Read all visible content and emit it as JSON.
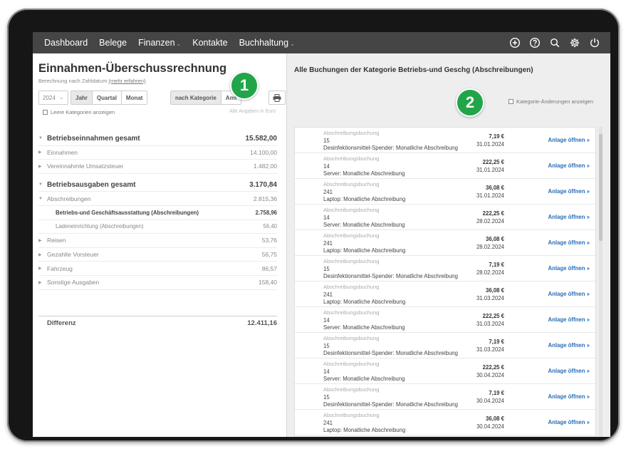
{
  "nav": {
    "items": [
      {
        "label": "Dashboard",
        "caret": false
      },
      {
        "label": "Belege",
        "caret": false
      },
      {
        "label": "Finanzen",
        "caret": true
      },
      {
        "label": "Kontakte",
        "caret": false
      },
      {
        "label": "Buchhaltung",
        "caret": true
      }
    ],
    "icons": [
      "add-circle-icon",
      "help-icon",
      "search-icon",
      "settings-icon",
      "power-icon"
    ]
  },
  "left": {
    "title": "Einnahmen-Überschussrechnung",
    "subtitle": "Berechnung nach Zahldatum",
    "learn_more": "(mehr erfahren)",
    "year": "2024",
    "period_buttons": [
      "Jahr",
      "Quartal",
      "Monat"
    ],
    "view_buttons": [
      "nach Kategorie",
      "Amt"
    ],
    "empty_categories_label": "Leere Kategorien anzeigen",
    "all_cents_label": "Alle Angaben in Euro",
    "rows": [
      {
        "kind": "group",
        "toggle": "▼",
        "label": "Betriebseinnahmen gesamt",
        "value": "15.582,00"
      },
      {
        "kind": "item",
        "toggle": "▶",
        "label": "Einnahmen",
        "value": "14.100,00"
      },
      {
        "kind": "item",
        "toggle": "▶",
        "label": "Vereinnahmte Umsatzsteuer",
        "value": "1.482,00"
      },
      {
        "kind": "group",
        "toggle": "▼",
        "label": "Betriebsausgaben gesamt",
        "value": "3.170,84"
      },
      {
        "kind": "item",
        "toggle": "▼",
        "label": "Abschreibungen",
        "value": "2.815,36"
      },
      {
        "kind": "subbold",
        "toggle": "",
        "label": "Betriebs-und Geschäftsausstattung (Abschreibungen)",
        "value": "2.758,96"
      },
      {
        "kind": "sub",
        "toggle": "",
        "label": "Ladeneinrichtung (Abschreibungen)",
        "value": "56,40"
      },
      {
        "kind": "item",
        "toggle": "▶",
        "label": "Reisen",
        "value": "53,76"
      },
      {
        "kind": "item",
        "toggle": "▶",
        "label": "Gezahlte Vorsteuer",
        "value": "56,75"
      },
      {
        "kind": "item",
        "toggle": "▶",
        "label": "Fahrzeug",
        "value": "86,57"
      },
      {
        "kind": "item",
        "toggle": "▶",
        "label": "Sonstige Ausgaben",
        "value": "158,40"
      }
    ],
    "difference_label": "Differenz",
    "difference_value": "12.411,16"
  },
  "right": {
    "title": "Alle Buchungen der Kategorie Betriebs-und Geschg (Abschreibungen)",
    "category_changes_label": "Kategorie-Änderungen anzeigen",
    "open_label": "Anlage öffnen",
    "entries": [
      {
        "type": "Abschreibungsbuchung",
        "number": "15",
        "description": "Desinfektionsmittel-Spender: Monatliche Abschreibung",
        "amount": "7,19 €",
        "date": "31.01.2024"
      },
      {
        "type": "Abschreibungsbuchung",
        "number": "14",
        "description": "Server: Monatliche Abschreibung",
        "amount": "222,25 €",
        "date": "31.01.2024"
      },
      {
        "type": "Abschreibungsbuchung",
        "number": "241",
        "description": "Laptop: Monatliche Abschreibung",
        "amount": "36,08 €",
        "date": "31.01.2024"
      },
      {
        "type": "Abschreibungsbuchung",
        "number": "14",
        "description": "Server: Monatliche Abschreibung",
        "amount": "222,25 €",
        "date": "28.02.2024"
      },
      {
        "type": "Abschreibungsbuchung",
        "number": "241",
        "description": "Laptop: Monatliche Abschreibung",
        "amount": "36,08 €",
        "date": "28.02.2024"
      },
      {
        "type": "Abschreibungsbuchung",
        "number": "15",
        "description": "Desinfektionsmittel-Spender: Monatliche Abschreibung",
        "amount": "7,19 €",
        "date": "28.02.2024"
      },
      {
        "type": "Abschreibungsbuchung",
        "number": "241",
        "description": "Laptop: Monatliche Abschreibung",
        "amount": "36,08 €",
        "date": "31.03.2024"
      },
      {
        "type": "Abschreibungsbuchung",
        "number": "14",
        "description": "Server: Monatliche Abschreibung",
        "amount": "222,25 €",
        "date": "31.03.2024"
      },
      {
        "type": "Abschreibungsbuchung",
        "number": "15",
        "description": "Desinfektionsmittel-Spender: Monatliche Abschreibung",
        "amount": "7,19 €",
        "date": "31.03.2024"
      },
      {
        "type": "Abschreibungsbuchung",
        "number": "14",
        "description": "Server: Monatliche Abschreibung",
        "amount": "222,25 €",
        "date": "30.04.2024"
      },
      {
        "type": "Abschreibungsbuchung",
        "number": "15",
        "description": "Desinfektionsmittel-Spender: Monatliche Abschreibung",
        "amount": "7,19 €",
        "date": "30.04.2024"
      },
      {
        "type": "Abschreibungsbuchung",
        "number": "241",
        "description": "Laptop: Monatliche Abschreibung",
        "amount": "36,08 €",
        "date": "30.04.2024"
      }
    ]
  },
  "badges": [
    "1",
    "2"
  ],
  "colors": {
    "badge": "#22a548",
    "link": "#2a6fb5",
    "nav_bg": "#454545"
  }
}
